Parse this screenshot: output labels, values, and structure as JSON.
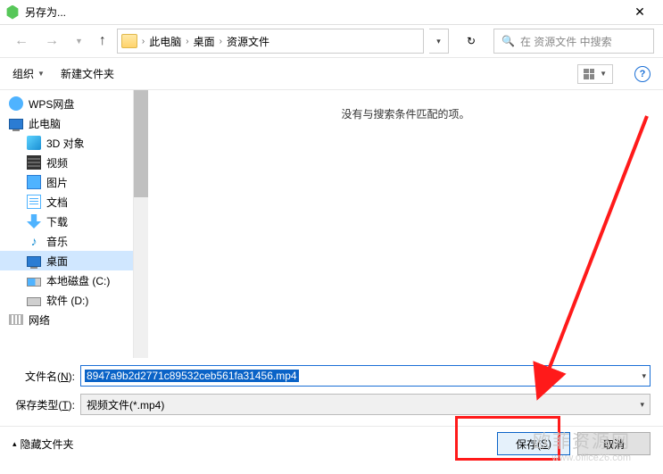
{
  "title": "另存为...",
  "breadcrumb": [
    "此电脑",
    "桌面",
    "资源文件"
  ],
  "search_placeholder": "在 资源文件 中搜索",
  "toolbar": {
    "organize": "组织",
    "new_folder": "新建文件夹"
  },
  "sidebar": [
    {
      "icon": "cloud",
      "label": "WPS网盘",
      "indent": false
    },
    {
      "icon": "pc",
      "label": "此电脑",
      "indent": false
    },
    {
      "icon": "3d",
      "label": "3D 对象",
      "indent": true
    },
    {
      "icon": "vid",
      "label": "视频",
      "indent": true
    },
    {
      "icon": "pic",
      "label": "图片",
      "indent": true
    },
    {
      "icon": "doc",
      "label": "文档",
      "indent": true
    },
    {
      "icon": "dl",
      "label": "下载",
      "indent": true
    },
    {
      "icon": "music",
      "label": "音乐",
      "indent": true
    },
    {
      "icon": "pc",
      "label": "桌面",
      "indent": true,
      "selected": true
    },
    {
      "icon": "drv-c",
      "label": "本地磁盘 (C:)",
      "indent": true
    },
    {
      "icon": "drv",
      "label": "软件 (D:)",
      "indent": true
    },
    {
      "icon": "net",
      "label": "网络",
      "indent": false
    }
  ],
  "empty_msg": "没有与搜索条件匹配的项。",
  "filename_label_pre": "文件名(",
  "filename_label_u": "N",
  "filename_label_post": "):",
  "filename_value": "8947a9b2d2771c89532ceb561fa31456.mp4",
  "filetype_label_pre": "保存类型(",
  "filetype_label_u": "T",
  "filetype_label_post": "):",
  "filetype_value": "视频文件(*.mp4)",
  "hide_folders": "隐藏文件夹",
  "save_btn_pre": "保存(",
  "save_btn_u": "S",
  "save_btn_post": ")",
  "cancel_btn": "取消",
  "watermark": {
    "l1": "欧菲资源网",
    "l2": "www.office26.com"
  },
  "chart_data": null
}
